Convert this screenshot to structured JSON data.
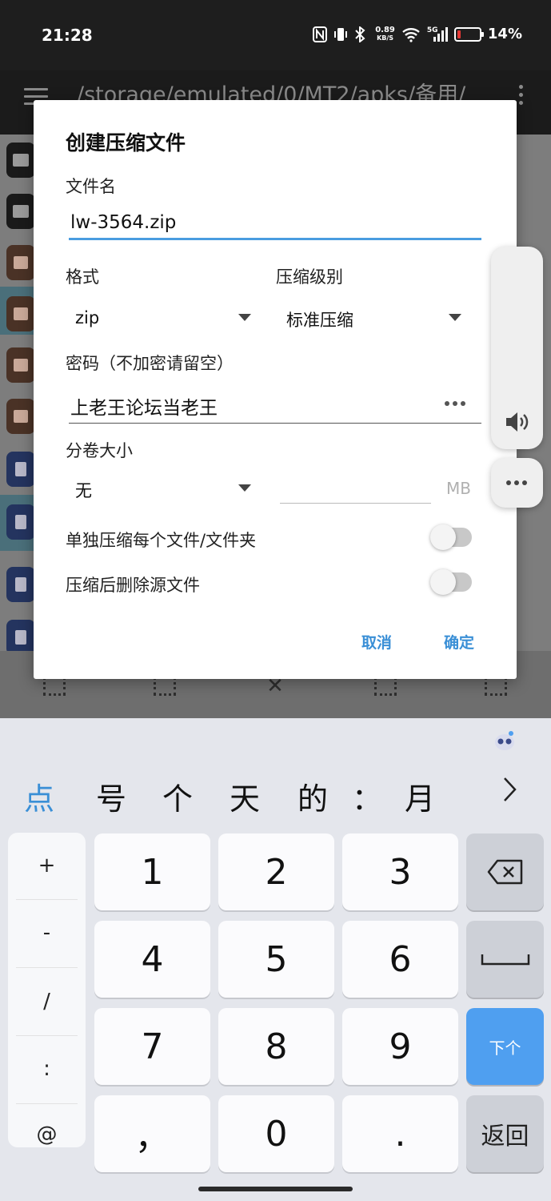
{
  "status_bar": {
    "time": "21:28",
    "net_speed_value": "0.89",
    "net_speed_unit": "KB/S",
    "signal_label": "5G",
    "battery": "14%",
    "battery_level": 0.14
  },
  "app_bar": {
    "path": "/storage/emulated/0/MT2/apks/备用/"
  },
  "dialog": {
    "title": "创建压缩文件",
    "filename_label": "文件名",
    "filename_value": "lw-3564.zip",
    "format_label": "格式",
    "format_value": "zip",
    "level_label": "压缩级别",
    "level_value": "标准压缩",
    "password_label": "密码（不加密请留空）",
    "password_value": "上老王论坛当老王",
    "split_label": "分卷大小",
    "split_value": "无",
    "split_unit": "MB",
    "separate_label": "单独压缩每个文件/文件夹",
    "delete_label": "压缩后删除源文件",
    "cancel": "取消",
    "confirm": "确定"
  },
  "keyboard": {
    "candidates": [
      "点",
      "号",
      "个",
      "天",
      "的",
      "：",
      "月"
    ],
    "symbols": [
      "+",
      "-",
      "/",
      ":",
      "@"
    ],
    "keys": [
      "1",
      "2",
      "3",
      "4",
      "5",
      "6",
      "7",
      "8",
      "9",
      "，",
      "0",
      "."
    ],
    "next_label": "下个",
    "return_label": "返回"
  },
  "colors": {
    "accent": "#3a8fd6",
    "next_key": "#4f9ff0",
    "battery_low": "#e53935"
  }
}
